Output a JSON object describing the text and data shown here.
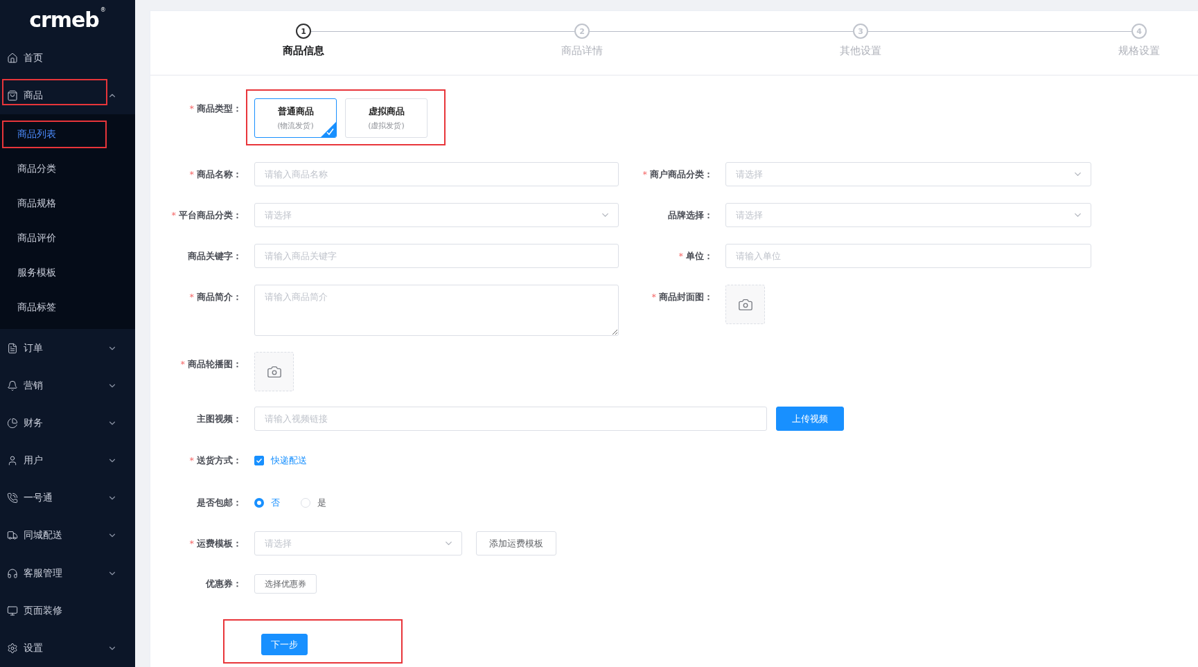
{
  "logo": {
    "text": "crmeb",
    "mark": "®"
  },
  "sidebar": {
    "items": [
      {
        "label": "首页"
      },
      {
        "label": "商品",
        "expanded": true,
        "annotated": true,
        "children": [
          {
            "label": "商品列表",
            "selected": true,
            "annotated": true
          },
          {
            "label": "商品分类",
            "selected": false,
            "annotated": false
          },
          {
            "label": "商品规格",
            "selected": false,
            "annotated": false
          },
          {
            "label": "商品评价",
            "selected": false,
            "annotated": false
          },
          {
            "label": "服务模板",
            "selected": false,
            "annotated": false
          },
          {
            "label": "商品标签",
            "selected": false,
            "annotated": false
          }
        ]
      },
      {
        "label": "订单",
        "expanded": false
      },
      {
        "label": "营销",
        "expanded": false
      },
      {
        "label": "财务",
        "expanded": false
      },
      {
        "label": "用户",
        "expanded": false
      },
      {
        "label": "一号通",
        "expanded": false
      },
      {
        "label": "同城配送",
        "expanded": false
      },
      {
        "label": "客服管理",
        "expanded": false
      },
      {
        "label": "页面装修"
      },
      {
        "label": "设置",
        "expanded": false
      }
    ]
  },
  "steps": [
    {
      "number": "1",
      "label": "商品信息",
      "selected": true
    },
    {
      "number": "2",
      "label": "商品详情",
      "selected": false
    },
    {
      "number": "3",
      "label": "其他设置",
      "selected": false
    },
    {
      "number": "4",
      "label": "规格设置",
      "selected": false
    }
  ],
  "form": {
    "product_type": {
      "required_mark": "*",
      "label": "商品类型：",
      "annotated": true,
      "options": [
        {
          "title": "普通商品",
          "subtitle": "(物流发货)",
          "selected": true
        },
        {
          "title": "虚拟商品",
          "subtitle": "(虚拟发货)",
          "selected": false
        }
      ]
    },
    "grid": [
      {
        "required_mark": "*",
        "label": "商品名称：",
        "kind": "input",
        "placeholder": "请输入商品名称"
      },
      {
        "required_mark": "*",
        "label": "商户商品分类：",
        "kind": "select",
        "placeholder": "请选择"
      },
      {
        "required_mark": "*",
        "label": "平台商品分类：",
        "kind": "select",
        "placeholder": "请选择"
      },
      {
        "label": "品牌选择：",
        "kind": "select",
        "placeholder": "请选择"
      },
      {
        "label": "商品关键字：",
        "kind": "input",
        "placeholder": "请输入商品关键字"
      },
      {
        "required_mark": "*",
        "label": "单位：",
        "kind": "input",
        "placeholder": "请输入单位"
      },
      {
        "required_mark": "*",
        "label": "商品简介：",
        "kind": "textarea",
        "placeholder": "请输入商品简介"
      },
      {
        "required_mark": "*",
        "label": "商品封面图：",
        "kind": "upload"
      }
    ],
    "rows": [
      {
        "required_mark": "*",
        "label": "商品轮播图：",
        "kind": "upload"
      },
      {
        "label": "主图视频：",
        "kind": "input_button",
        "placeholder": "请输入视频链接",
        "button": "上传视频"
      },
      {
        "required_mark": "*",
        "label": "送货方式：",
        "kind": "checkbox",
        "option": {
          "label": "快递配送",
          "checked": true
        }
      },
      {
        "label": "是否包邮：",
        "kind": "radio",
        "options": [
          {
            "label": "否",
            "selected": true
          },
          {
            "label": "是",
            "selected": false
          }
        ]
      },
      {
        "required_mark": "*",
        "label": "运费模板：",
        "kind": "select_button",
        "placeholder": "请选择",
        "button": "添加运费模板"
      },
      {
        "label": "优惠券：",
        "kind": "button",
        "button": "选择优惠券"
      }
    ],
    "next_button": {
      "label": "下一步",
      "annotated": true
    }
  }
}
